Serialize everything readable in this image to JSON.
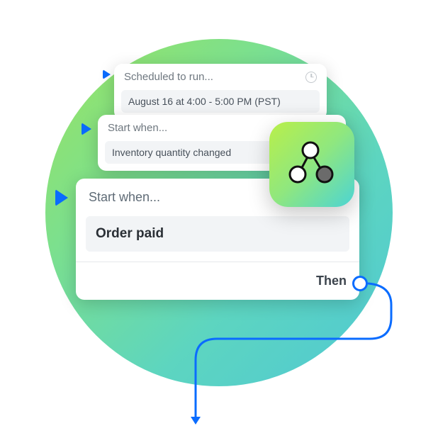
{
  "cards": {
    "back": {
      "header": "Scheduled to run...",
      "body": "August 16 at 4:00 - 5:00 PM (PST)"
    },
    "mid": {
      "header": "Start when...",
      "body": "Inventory quantity changed"
    },
    "front": {
      "header": "Start when...",
      "body": "Order paid",
      "footer": "Then"
    }
  }
}
